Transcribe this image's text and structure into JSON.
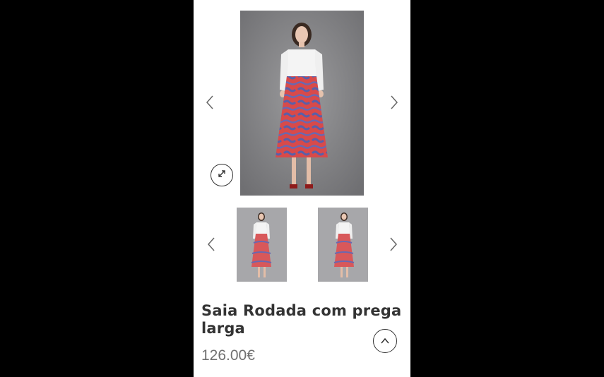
{
  "product": {
    "title": "Saia Rodada com prega larga",
    "price": "126.00€"
  },
  "gallery": {
    "main_image_alt": "model-in-white-shirt-red-skirt",
    "icons": {
      "prev": "chevron-left-icon",
      "next": "chevron-right-icon",
      "zoom": "expand-icon",
      "scroll_top": "chevron-up-icon"
    }
  },
  "colors": {
    "page_background": "#000000",
    "card_background": "#ffffff",
    "title_text": "#333333",
    "price_text": "#707070",
    "skirt_red": "#d84a4a",
    "skirt_pattern": "#5a5fa8"
  }
}
